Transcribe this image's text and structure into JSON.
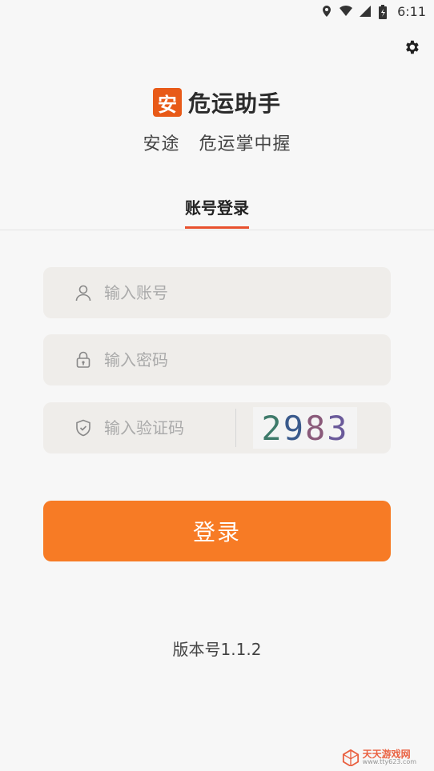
{
  "status_bar": {
    "time": "6:11",
    "icons": [
      "location-icon",
      "wifi-icon",
      "signal-icon",
      "battery-icon"
    ]
  },
  "settings": {
    "icon": "gear-icon"
  },
  "brand": {
    "logo_char": "安",
    "app_name": "危运助手",
    "slogan": "安途   危运掌中握"
  },
  "tab": {
    "label": "账号登录"
  },
  "form": {
    "account": {
      "placeholder": "输入账号",
      "value": ""
    },
    "password": {
      "placeholder": "输入密码",
      "value": ""
    },
    "captcha": {
      "placeholder": "输入验证码",
      "value": "",
      "image_text": "2983"
    }
  },
  "login_button": {
    "label": "登录"
  },
  "version": "版本号1.1.2",
  "watermark": {
    "title": "天天游戏网",
    "subtitle": "www.tty623.com"
  },
  "colors": {
    "accent": "#f77b25",
    "tab_underline": "#e8502d",
    "logo": "#e85a18"
  }
}
